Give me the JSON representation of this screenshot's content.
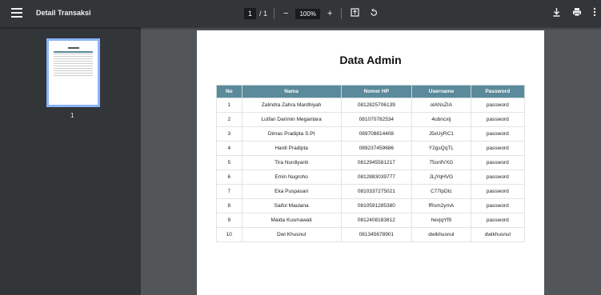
{
  "toolbar": {
    "title": "Detail Transaksi",
    "page_current": "1",
    "page_total": "/ 1",
    "zoom": "100%",
    "icons": [
      "menu-icon",
      "zoom-out-icon",
      "zoom-in-icon",
      "fit-page-icon",
      "rotate-icon",
      "download-icon",
      "print-icon",
      "more-icon"
    ]
  },
  "sidebar": {
    "page_label": "1"
  },
  "document": {
    "title": "Data Admin",
    "headers": [
      "No",
      "Nama",
      "Nomer HP",
      "Username",
      "Password"
    ],
    "rows": [
      [
        "1",
        "Zalindra Zahra Mardhiyah",
        "0812825706139",
        "olANsZIA",
        "password"
      ],
      [
        "2",
        "Lutfan Darimin Megantara",
        "081070782534",
        "4ubncxij",
        "password"
      ],
      [
        "3",
        "Dimas Pradipta S.Pt",
        "089708814408",
        "J5xUyRC1",
        "password"
      ],
      [
        "4",
        "Hardi Pradipta",
        "089237459686",
        "Y2gsQqTL",
        "password"
      ],
      [
        "5",
        "Tira Nurdiyanti",
        "0812945581217",
        "75onfVXG",
        "password"
      ],
      [
        "6",
        "Emin Nugroho",
        "0812883039777",
        "JLjYqHVG",
        "password"
      ],
      [
        "7",
        "Eka Puspasari",
        "0810337275021",
        "C77lpDtc",
        "password"
      ],
      [
        "8",
        "Saiful Maulana",
        "0810591285380",
        "fRsm2ymA",
        "password"
      ],
      [
        "9",
        "Maida Kusmawati",
        "0812408183812",
        "hevjqYf9",
        "password"
      ],
      [
        "10",
        "Dwi Khusnul",
        "081345678901",
        "dwikhusnul",
        "dwikhusnul"
      ]
    ]
  },
  "colors": {
    "toolbar": "#323639",
    "viewer": "#525659",
    "table_header": "#5b8a9a",
    "thumb_border": "#8ab4f8"
  }
}
